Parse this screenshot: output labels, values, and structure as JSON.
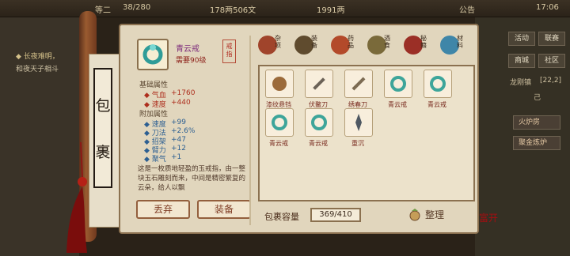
{
  "topbar": {
    "left_num": "等二",
    "progress": "38/280",
    "money_a": "178两506文",
    "money_b": "1991两",
    "notice": "公告",
    "time": "17:06"
  },
  "left_bg": {
    "line1": "◆ 长夜难明，",
    "line2": "和夜天子相斗"
  },
  "right_bg": {
    "btn1": "活动",
    "btn2": "联赛",
    "btn3": "商城",
    "btn4": "社区",
    "mid1": "龙刚镇",
    "mid2": "[22,2]",
    "mid3": "己",
    "list1": "火炉房",
    "list2": "聚金炼炉"
  },
  "side_text": [
    "包",
    "裹"
  ],
  "item": {
    "name": "青云戒",
    "level": "需要90级",
    "tag": "戒指"
  },
  "stats": {
    "base_header": "基础属性",
    "base": [
      {
        "label": "◆ 气血",
        "value": "+1760"
      },
      {
        "label": "◆ 速度",
        "value": "+440"
      }
    ],
    "extra_header": "附加属性",
    "extra": [
      {
        "label": "◆ 速度",
        "value": "+99"
      },
      {
        "label": "◆ 刀法",
        "value": "+2.6%"
      },
      {
        "label": "◆ 招架",
        "value": "+47"
      },
      {
        "label": "◆ 臂力",
        "value": "+12"
      },
      {
        "label": "◆ 聚气",
        "value": "+1"
      }
    ]
  },
  "description": "这是一枚质地轻盈的玉戒指，由一整块玉石雕刻而来，中间是精密繁复的云朵，给人以飘",
  "buttons": {
    "discard": "丢弃",
    "equip": "装备"
  },
  "categories": [
    {
      "label": "杂项",
      "color": "#a0442b"
    },
    {
      "label": "装备",
      "color": "#5f4b2e"
    },
    {
      "label": "药品",
      "color": "#b34a2a"
    },
    {
      "label": "酒食",
      "color": "#7a6a3a"
    },
    {
      "label": "秘籍",
      "color": "#9b2f26"
    },
    {
      "label": "材料",
      "color": "#3f86a8"
    }
  ],
  "inventory": [
    {
      "name": "漆纹悬铛",
      "color": "#9b6a3a"
    },
    {
      "name": "伏鳌刀",
      "color": "#6b6257"
    },
    {
      "name": "绣春刀",
      "color": "#7c6b52"
    },
    {
      "name": "青云戒",
      "color": "#3ea59a"
    },
    {
      "name": "青云戒",
      "color": "#3ea59a"
    },
    {
      "name": "青云戒",
      "color": "#3ea59a"
    },
    {
      "name": "青云戒",
      "color": "#3ea59a"
    },
    {
      "name": "重沉",
      "color": "#4f5862"
    }
  ],
  "capacity": {
    "label": "包裹容量",
    "value": "369/410"
  },
  "sort_label": "整理",
  "seal_text": "富开"
}
